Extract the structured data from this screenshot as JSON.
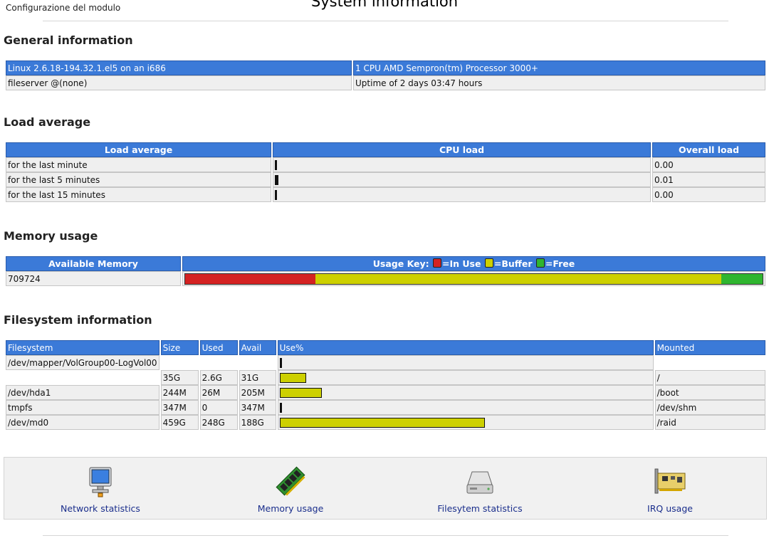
{
  "header": {
    "module_config_link": "Configurazione del modulo",
    "title": "System information"
  },
  "general": {
    "section_title": "General information",
    "row1": {
      "left": "Linux 2.6.18-194.32.1.el5 on an i686",
      "right": "1 CPU AMD Sempron(tm) Processor 3000+"
    },
    "row2": {
      "left": "fileserver @(none)",
      "right": "Uptime of 2 days 03:47 hours"
    }
  },
  "load": {
    "section_title": "Load average",
    "headers": [
      "Load average",
      "CPU load",
      "Overall load"
    ],
    "rows": [
      {
        "label": "for the last minute",
        "cpu_load_fraction": 0.0,
        "overall": "0.00"
      },
      {
        "label": "for the last 5 minutes",
        "cpu_load_fraction": 0.01,
        "overall": "0.01"
      },
      {
        "label": "for the last 15 minutes",
        "cpu_load_fraction": 0.0,
        "overall": "0.00"
      }
    ]
  },
  "memory": {
    "section_title": "Memory usage",
    "header_available": "Available Memory",
    "usage_key_label": "Usage Key:",
    "key_in_use": "=In Use",
    "key_buffer": "=Buffer",
    "key_free": "=Free",
    "available_value": "709724",
    "in_use_fraction": 0.226,
    "buffer_fraction": 0.702,
    "free_fraction": 0.072,
    "colors": {
      "in_use": "#d42222",
      "buffer": "#cdd000",
      "free": "#2fb52f"
    }
  },
  "filesystem": {
    "section_title": "Filesystem information",
    "headers": [
      "Filesystem",
      "Size",
      "Used",
      "Avail",
      "Use%",
      "Mounted"
    ],
    "rows": [
      {
        "filesystem": "/dev/mapper/VolGroup00-LogVol00",
        "size": "",
        "used": "",
        "avail": "",
        "use_fraction": 0.0,
        "mounted": ""
      },
      {
        "filesystem": "",
        "size": "35G",
        "used": "2.6G",
        "avail": "31G",
        "use_fraction": 0.067,
        "mounted": "/"
      },
      {
        "filesystem": "/dev/hda1",
        "size": "244M",
        "used": "26M",
        "avail": "205M",
        "use_fraction": 0.11,
        "mounted": "/boot"
      },
      {
        "filesystem": "tmpfs",
        "size": "347M",
        "used": "0",
        "avail": "347M",
        "use_fraction": 0.0,
        "mounted": "/dev/shm"
      },
      {
        "filesystem": "/dev/md0",
        "size": "459G",
        "used": "248G",
        "avail": "188G",
        "use_fraction": 0.555,
        "mounted": "/raid"
      }
    ]
  },
  "footer_nav": [
    {
      "label": "Network statistics",
      "icon": "network-computer-icon"
    },
    {
      "label": "Memory usage",
      "icon": "memory-chip-icon"
    },
    {
      "label": "Filesytem statistics",
      "icon": "hard-drive-icon"
    },
    {
      "label": "IRQ usage",
      "icon": "expansion-card-icon"
    }
  ]
}
